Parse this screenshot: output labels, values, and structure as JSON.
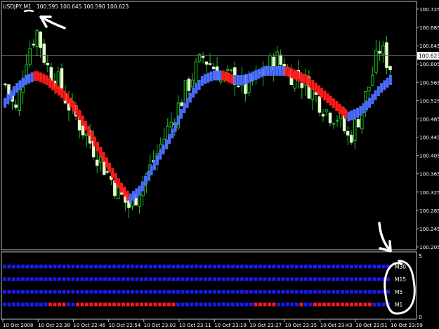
{
  "header": {
    "symbol": "USDJPY,M1",
    "ohlc": "100.595 100.645 100.590 100.623"
  },
  "colors": {
    "background": "#000000",
    "frame": "#bfbfbf",
    "grid": "#6a6a6a",
    "bull": "#1fbf1f",
    "bear": "#e6ffcc",
    "ma_up": "#4a6cff",
    "ma_down": "#ff1a1a",
    "strip_blue": "#1a1aff",
    "strip_red": "#ff1a1a",
    "annotation": "#ffffff"
  },
  "chart_data": {
    "type": "candlestick",
    "ylim": [
      100.205,
      100.725
    ],
    "price_ticks": [
      "100.725",
      "100.685",
      "100.645",
      "100.605",
      "100.565",
      "100.525",
      "100.485",
      "100.445",
      "100.405",
      "100.365",
      "100.325",
      "100.285",
      "100.245",
      "100.205"
    ],
    "current_price": "100.623",
    "time_labels": [
      "10 Oct 2008",
      "10 Oct 22:38",
      "10 Oct 22:46",
      "10 Oct 22:54",
      "10 Oct 23:02",
      "10 Oct 23:11",
      "10 Oct 23:19",
      "10 Oct 23:27",
      "10 Oct 23:35",
      "10 Oct 23:43",
      "10 Oct 23:51",
      "10 Oct 23:59"
    ],
    "close_path": [
      100.56,
      100.5,
      100.62,
      100.68,
      100.6,
      100.57,
      100.52,
      100.48,
      100.44,
      100.4,
      100.36,
      100.32,
      100.29,
      100.34,
      100.38,
      100.43,
      100.48,
      100.53,
      100.58,
      100.62,
      100.6,
      100.57,
      100.58,
      100.55,
      100.57,
      100.59,
      100.62,
      100.59,
      100.58,
      100.56,
      100.53,
      100.5,
      100.49,
      100.44,
      100.49,
      100.56,
      100.64,
      100.6
    ],
    "ma_path": [
      100.52,
      100.55,
      100.57,
      100.58,
      100.57,
      100.55,
      100.53,
      100.5,
      100.46,
      100.42,
      100.38,
      100.34,
      100.31,
      100.33,
      100.37,
      100.41,
      100.45,
      100.5,
      100.54,
      100.57,
      100.58,
      100.58,
      100.57,
      100.57,
      100.58,
      100.59,
      100.59,
      100.59,
      100.58,
      100.57,
      100.55,
      100.53,
      100.51,
      100.49,
      100.5,
      100.52,
      100.55,
      100.57
    ],
    "indicator": {
      "scale_labels": [
        "5",
        "0"
      ],
      "rows": [
        {
          "label": "M30",
          "red_runs": []
        },
        {
          "label": "M15",
          "red_runs": []
        },
        {
          "label": "M5",
          "red_runs": []
        },
        {
          "label": "M1",
          "red_runs": [
            [
              0.11,
              0.16
            ],
            [
              0.18,
              0.44
            ],
            [
              0.65,
              0.7
            ],
            [
              0.76,
              0.78
            ],
            [
              0.8,
              0.95
            ]
          ]
        }
      ]
    }
  }
}
